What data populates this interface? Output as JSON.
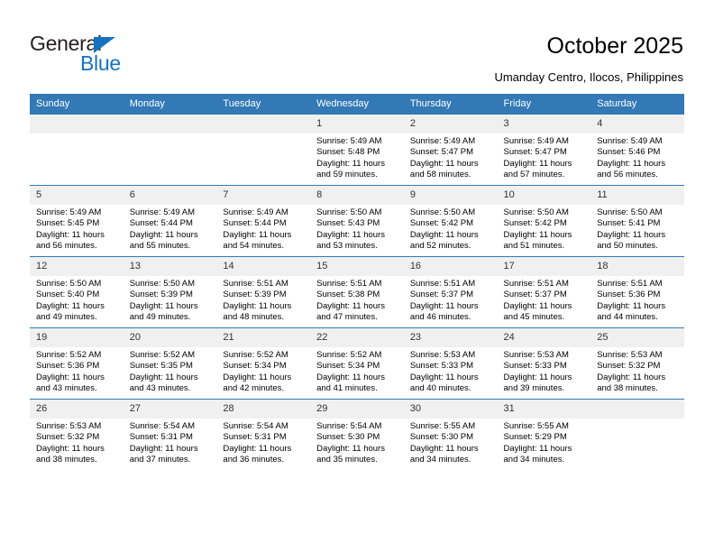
{
  "brand": {
    "name_top": "General",
    "name_bottom": "Blue",
    "color_primary": "#1573bf",
    "color_text": "#231f20"
  },
  "header": {
    "title": "October 2025",
    "subtitle": "Umanday Centro, Ilocos, Philippines"
  },
  "calendar": {
    "header_bg": "#3279b6",
    "daynum_bg": "#f0f0f0",
    "weekday_headers": [
      "Sunday",
      "Monday",
      "Tuesday",
      "Wednesday",
      "Thursday",
      "Friday",
      "Saturday"
    ],
    "weeks": [
      [
        {
          "day": "",
          "empty": true
        },
        {
          "day": "",
          "empty": true
        },
        {
          "day": "",
          "empty": true
        },
        {
          "day": "1",
          "sunrise": "Sunrise: 5:49 AM",
          "sunset": "Sunset: 5:48 PM",
          "daylight_line1": "Daylight: 11 hours",
          "daylight_line2": "and 59 minutes."
        },
        {
          "day": "2",
          "sunrise": "Sunrise: 5:49 AM",
          "sunset": "Sunset: 5:47 PM",
          "daylight_line1": "Daylight: 11 hours",
          "daylight_line2": "and 58 minutes."
        },
        {
          "day": "3",
          "sunrise": "Sunrise: 5:49 AM",
          "sunset": "Sunset: 5:47 PM",
          "daylight_line1": "Daylight: 11 hours",
          "daylight_line2": "and 57 minutes."
        },
        {
          "day": "4",
          "sunrise": "Sunrise: 5:49 AM",
          "sunset": "Sunset: 5:46 PM",
          "daylight_line1": "Daylight: 11 hours",
          "daylight_line2": "and 56 minutes."
        }
      ],
      [
        {
          "day": "5",
          "sunrise": "Sunrise: 5:49 AM",
          "sunset": "Sunset: 5:45 PM",
          "daylight_line1": "Daylight: 11 hours",
          "daylight_line2": "and 56 minutes."
        },
        {
          "day": "6",
          "sunrise": "Sunrise: 5:49 AM",
          "sunset": "Sunset: 5:44 PM",
          "daylight_line1": "Daylight: 11 hours",
          "daylight_line2": "and 55 minutes."
        },
        {
          "day": "7",
          "sunrise": "Sunrise: 5:49 AM",
          "sunset": "Sunset: 5:44 PM",
          "daylight_line1": "Daylight: 11 hours",
          "daylight_line2": "and 54 minutes."
        },
        {
          "day": "8",
          "sunrise": "Sunrise: 5:50 AM",
          "sunset": "Sunset: 5:43 PM",
          "daylight_line1": "Daylight: 11 hours",
          "daylight_line2": "and 53 minutes."
        },
        {
          "day": "9",
          "sunrise": "Sunrise: 5:50 AM",
          "sunset": "Sunset: 5:42 PM",
          "daylight_line1": "Daylight: 11 hours",
          "daylight_line2": "and 52 minutes."
        },
        {
          "day": "10",
          "sunrise": "Sunrise: 5:50 AM",
          "sunset": "Sunset: 5:42 PM",
          "daylight_line1": "Daylight: 11 hours",
          "daylight_line2": "and 51 minutes."
        },
        {
          "day": "11",
          "sunrise": "Sunrise: 5:50 AM",
          "sunset": "Sunset: 5:41 PM",
          "daylight_line1": "Daylight: 11 hours",
          "daylight_line2": "and 50 minutes."
        }
      ],
      [
        {
          "day": "12",
          "sunrise": "Sunrise: 5:50 AM",
          "sunset": "Sunset: 5:40 PM",
          "daylight_line1": "Daylight: 11 hours",
          "daylight_line2": "and 49 minutes."
        },
        {
          "day": "13",
          "sunrise": "Sunrise: 5:50 AM",
          "sunset": "Sunset: 5:39 PM",
          "daylight_line1": "Daylight: 11 hours",
          "daylight_line2": "and 49 minutes."
        },
        {
          "day": "14",
          "sunrise": "Sunrise: 5:51 AM",
          "sunset": "Sunset: 5:39 PM",
          "daylight_line1": "Daylight: 11 hours",
          "daylight_line2": "and 48 minutes."
        },
        {
          "day": "15",
          "sunrise": "Sunrise: 5:51 AM",
          "sunset": "Sunset: 5:38 PM",
          "daylight_line1": "Daylight: 11 hours",
          "daylight_line2": "and 47 minutes."
        },
        {
          "day": "16",
          "sunrise": "Sunrise: 5:51 AM",
          "sunset": "Sunset: 5:37 PM",
          "daylight_line1": "Daylight: 11 hours",
          "daylight_line2": "and 46 minutes."
        },
        {
          "day": "17",
          "sunrise": "Sunrise: 5:51 AM",
          "sunset": "Sunset: 5:37 PM",
          "daylight_line1": "Daylight: 11 hours",
          "daylight_line2": "and 45 minutes."
        },
        {
          "day": "18",
          "sunrise": "Sunrise: 5:51 AM",
          "sunset": "Sunset: 5:36 PM",
          "daylight_line1": "Daylight: 11 hours",
          "daylight_line2": "and 44 minutes."
        }
      ],
      [
        {
          "day": "19",
          "sunrise": "Sunrise: 5:52 AM",
          "sunset": "Sunset: 5:36 PM",
          "daylight_line1": "Daylight: 11 hours",
          "daylight_line2": "and 43 minutes."
        },
        {
          "day": "20",
          "sunrise": "Sunrise: 5:52 AM",
          "sunset": "Sunset: 5:35 PM",
          "daylight_line1": "Daylight: 11 hours",
          "daylight_line2": "and 43 minutes."
        },
        {
          "day": "21",
          "sunrise": "Sunrise: 5:52 AM",
          "sunset": "Sunset: 5:34 PM",
          "daylight_line1": "Daylight: 11 hours",
          "daylight_line2": "and 42 minutes."
        },
        {
          "day": "22",
          "sunrise": "Sunrise: 5:52 AM",
          "sunset": "Sunset: 5:34 PM",
          "daylight_line1": "Daylight: 11 hours",
          "daylight_line2": "and 41 minutes."
        },
        {
          "day": "23",
          "sunrise": "Sunrise: 5:53 AM",
          "sunset": "Sunset: 5:33 PM",
          "daylight_line1": "Daylight: 11 hours",
          "daylight_line2": "and 40 minutes."
        },
        {
          "day": "24",
          "sunrise": "Sunrise: 5:53 AM",
          "sunset": "Sunset: 5:33 PM",
          "daylight_line1": "Daylight: 11 hours",
          "daylight_line2": "and 39 minutes."
        },
        {
          "day": "25",
          "sunrise": "Sunrise: 5:53 AM",
          "sunset": "Sunset: 5:32 PM",
          "daylight_line1": "Daylight: 11 hours",
          "daylight_line2": "and 38 minutes."
        }
      ],
      [
        {
          "day": "26",
          "sunrise": "Sunrise: 5:53 AM",
          "sunset": "Sunset: 5:32 PM",
          "daylight_line1": "Daylight: 11 hours",
          "daylight_line2": "and 38 minutes."
        },
        {
          "day": "27",
          "sunrise": "Sunrise: 5:54 AM",
          "sunset": "Sunset: 5:31 PM",
          "daylight_line1": "Daylight: 11 hours",
          "daylight_line2": "and 37 minutes."
        },
        {
          "day": "28",
          "sunrise": "Sunrise: 5:54 AM",
          "sunset": "Sunset: 5:31 PM",
          "daylight_line1": "Daylight: 11 hours",
          "daylight_line2": "and 36 minutes."
        },
        {
          "day": "29",
          "sunrise": "Sunrise: 5:54 AM",
          "sunset": "Sunset: 5:30 PM",
          "daylight_line1": "Daylight: 11 hours",
          "daylight_line2": "and 35 minutes."
        },
        {
          "day": "30",
          "sunrise": "Sunrise: 5:55 AM",
          "sunset": "Sunset: 5:30 PM",
          "daylight_line1": "Daylight: 11 hours",
          "daylight_line2": "and 34 minutes."
        },
        {
          "day": "31",
          "sunrise": "Sunrise: 5:55 AM",
          "sunset": "Sunset: 5:29 PM",
          "daylight_line1": "Daylight: 11 hours",
          "daylight_line2": "and 34 minutes."
        },
        {
          "day": "",
          "empty": true
        }
      ]
    ]
  }
}
